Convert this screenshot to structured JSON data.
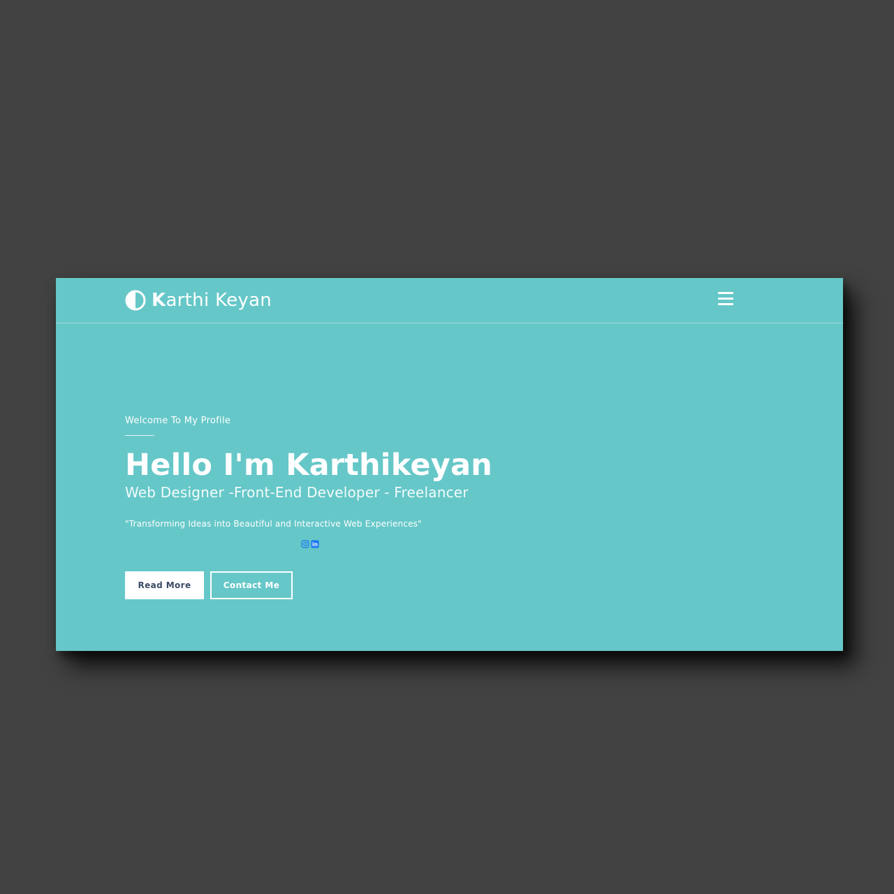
{
  "header": {
    "brand_initial": "K",
    "brand_rest": "arthi Keyan",
    "logo_icon": "half-circle-contrast-icon",
    "menu_icon": "hamburger-menu-icon"
  },
  "hero": {
    "welcome": "Welcome To My Profile",
    "title": "Hello I'm Karthikeyan",
    "subtitle": "Web Designer -Front-End Developer - Freelancer",
    "quote": "\"Transforming Ideas into Beautiful and Interactive Web Experiences\"",
    "social": [
      {
        "icon": "instagram-icon"
      },
      {
        "icon": "linkedin-icon",
        "text": "in"
      }
    ],
    "buttons": {
      "read_more": "Read More",
      "contact": "Contact Me"
    }
  },
  "colors": {
    "background": "#424242",
    "hero_bg": "#66c7c8",
    "social_accent": "#1877f2",
    "primary_button_text": "#3a4a66"
  }
}
